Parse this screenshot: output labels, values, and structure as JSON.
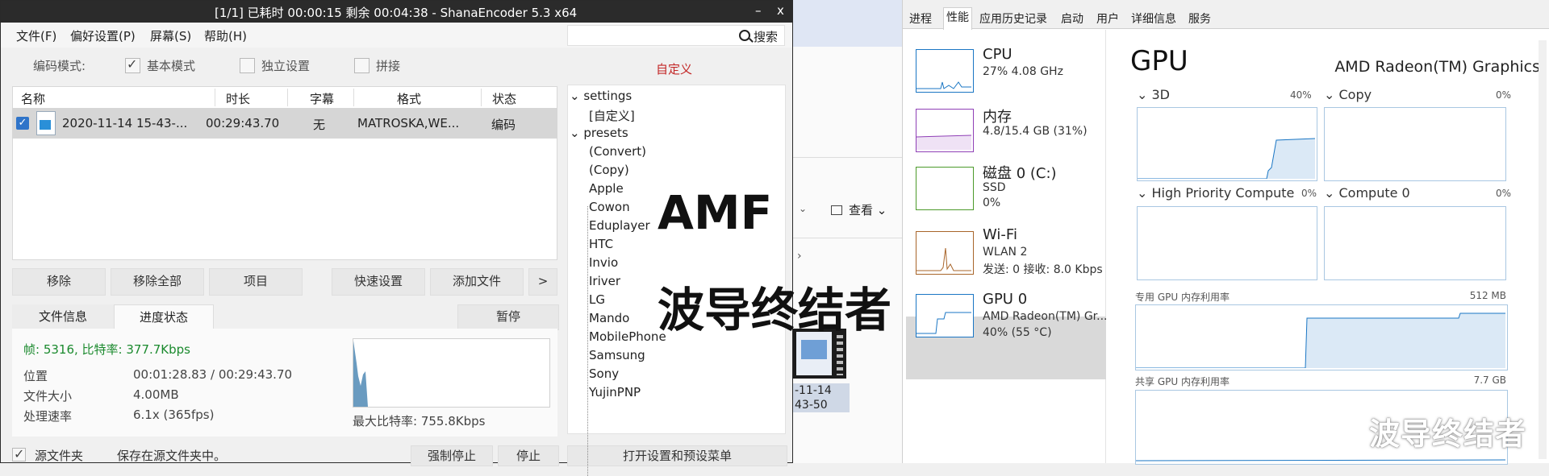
{
  "encoder": {
    "title": "[1/1] 已耗时 00:00:15   剩余 00:04:38 - ShanaEncoder  5.3  x64",
    "menu": [
      "文件(F)",
      "偏好设置(P)",
      "屏幕(S)",
      "帮助(H)"
    ],
    "search_label": "搜索",
    "mode_label": "编码模式:",
    "modes": [
      "基本模式",
      "独立设置",
      "拼接"
    ],
    "custom_label": "自定义",
    "columns": [
      "名称",
      "时长",
      "字幕",
      "格式",
      "状态"
    ],
    "file": {
      "name": "2020-11-14 15-43-...",
      "duration": "00:29:43.70",
      "subtitle": "无",
      "format": "MATROSKA,WE...",
      "status": "编码"
    },
    "buttons": [
      "移除",
      "移除全部",
      "项目",
      "快速设置",
      "添加文件",
      ">"
    ],
    "tabs": [
      "文件信息",
      "进度状态"
    ],
    "pause": "暂停",
    "frame_info": "帧: 5316, 比特率: 377.7Kbps",
    "stats": [
      {
        "label": "位置",
        "value": "00:01:28.83 / 00:29:43.70"
      },
      {
        "label": "文件大小",
        "value": "4.00MB"
      },
      {
        "label": "处理速率",
        "value": "6.1x (365fps)"
      }
    ],
    "max_bitrate": "最大比特率: 755.8Kbps",
    "bottom": {
      "source_checkbox": "源文件夹",
      "save_note": "保存在源文件夹中。",
      "force_stop": "强制停止",
      "stop": "停止",
      "open_settings": "打开设置和预设菜单"
    },
    "tree": {
      "settings": "settings",
      "custom": "[自定义]",
      "presets": "presets",
      "items": [
        "(Convert)",
        "(Copy)",
        "Apple",
        "Cowon",
        "Eduplayer",
        "HTC",
        "Invio",
        "Iriver",
        "LG",
        "Mando",
        "MobilePhone",
        "Samsung",
        "Sony",
        "YujinPNP"
      ]
    }
  },
  "overlay": {
    "line1": "AMF",
    "line2": "波导终结者",
    "watermark": "波导终结者"
  },
  "explorer": {
    "view_label": "查看",
    "thumb_name": "-11-14\n43-50"
  },
  "taskmgr": {
    "tabs": [
      "进程",
      "性能",
      "应用历史记录",
      "启动",
      "用户",
      "详细信息",
      "服务"
    ],
    "side": [
      {
        "name": "CPU",
        "sub1": "27% 4.08 GHz",
        "sub2": ""
      },
      {
        "name": "内存",
        "sub1": "4.8/15.4 GB (31%)",
        "sub2": ""
      },
      {
        "name": "磁盘 0 (C:)",
        "sub1": "SSD",
        "sub2": "0%"
      },
      {
        "name": "Wi-Fi",
        "sub1": "WLAN 2",
        "sub2": "发送: 0 接收: 8.0 Kbps"
      },
      {
        "name": "GPU 0",
        "sub1": "AMD Radeon(TM) Gr...",
        "sub2": "40% (55 °C)"
      }
    ],
    "gpu_title": "GPU",
    "gpu_name": "AMD Radeon(TM) Graphics",
    "engines": [
      {
        "label": "3D",
        "pct": "40%"
      },
      {
        "label": "Copy",
        "pct": "0%"
      },
      {
        "label": "High Priority Compute",
        "pct": "0%"
      },
      {
        "label": "Compute 0",
        "pct": "0%"
      }
    ],
    "dedicated": {
      "label": "专用 GPU 内存利用率",
      "max": "512 MB"
    },
    "shared": {
      "label": "共享 GPU 内存利用率",
      "max": "7.7 GB"
    },
    "colors": {
      "cpu": "#1a76c4",
      "memory": "#8f3fb6",
      "disk": "#4c9a2a",
      "wifi": "#a8652a",
      "gpu": "#1a76c4"
    }
  }
}
